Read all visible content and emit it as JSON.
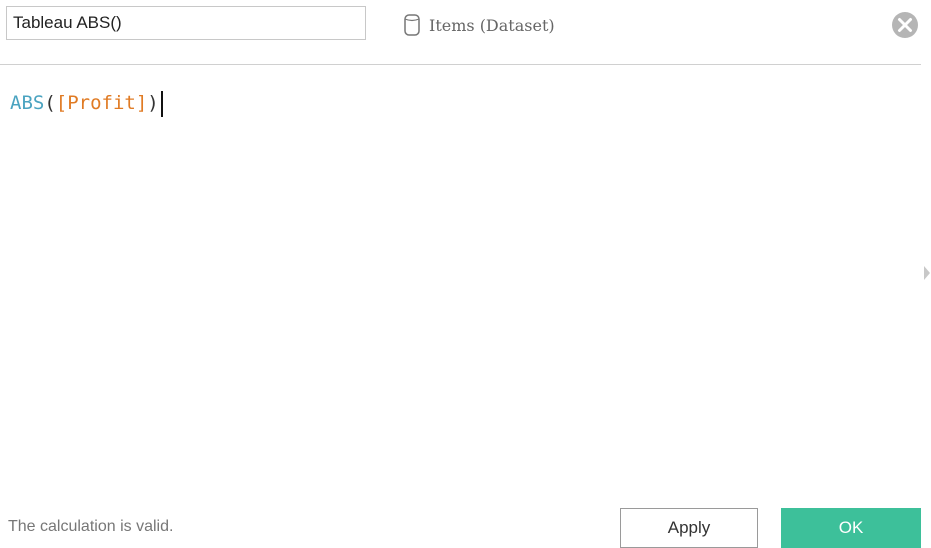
{
  "header": {
    "calc_name": "Tableau ABS()",
    "datasource_label": "Items (Dataset)",
    "datasource_icon": "database-icon",
    "close_icon": "close-icon"
  },
  "editor": {
    "tokens": {
      "function": "ABS",
      "open_paren": "(",
      "field": "[Profit]",
      "close_paren": ")"
    }
  },
  "footer": {
    "status": "The calculation is valid.",
    "apply_label": "Apply",
    "ok_label": "OK"
  },
  "colors": {
    "function_token": "#4aa3c0",
    "field_token": "#e07b24",
    "ok_button": "#3dc09a"
  }
}
